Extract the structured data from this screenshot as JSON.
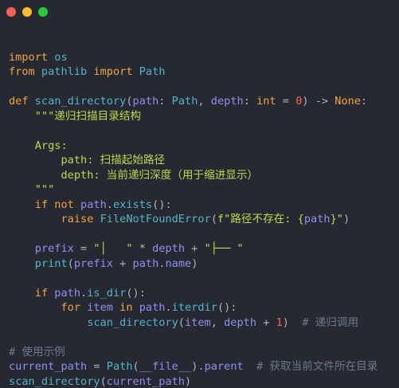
{
  "window": {
    "background": "#262932",
    "dots": [
      {
        "name": "close",
        "color": "#ff5f56"
      },
      {
        "name": "minimize",
        "color": "#ffbd2e"
      },
      {
        "name": "maximize",
        "color": "#27c93f"
      }
    ]
  },
  "palette": {
    "keyword": "#f0a53c",
    "func": "#52b4c9",
    "type": "#f0a53c",
    "plain": "#abb2bf",
    "variable": "#8f8ff0",
    "param": "#8f8ff0",
    "number": "#ff5f56",
    "string": "#bfd84a",
    "comment": "#6c7a8a"
  },
  "code": {
    "lines": [
      [],
      [
        {
          "t": "import",
          "c": "keyword"
        },
        {
          "t": " os",
          "c": "func"
        }
      ],
      [
        {
          "t": "from",
          "c": "keyword"
        },
        {
          "t": " pathlib ",
          "c": "func"
        },
        {
          "t": "import",
          "c": "keyword"
        },
        {
          "t": " Path",
          "c": "func"
        }
      ],
      [],
      [
        {
          "t": "def",
          "c": "keyword"
        },
        {
          "t": " scan_directory",
          "c": "func"
        },
        {
          "t": "(",
          "c": "plain"
        },
        {
          "t": "path",
          "c": "param"
        },
        {
          "t": ": ",
          "c": "plain"
        },
        {
          "t": "Path",
          "c": "func"
        },
        {
          "t": ", ",
          "c": "plain"
        },
        {
          "t": "depth",
          "c": "param"
        },
        {
          "t": ": ",
          "c": "plain"
        },
        {
          "t": "int",
          "c": "type"
        },
        {
          "t": " = ",
          "c": "plain"
        },
        {
          "t": "0",
          "c": "number"
        },
        {
          "t": ") -> ",
          "c": "plain"
        },
        {
          "t": "None",
          "c": "keyword"
        },
        {
          "t": ":",
          "c": "plain"
        }
      ],
      [
        {
          "t": "    \"\"\"递归扫描目录结构",
          "c": "string"
        }
      ],
      [],
      [
        {
          "t": "    Args:",
          "c": "string"
        }
      ],
      [
        {
          "t": "        path: 扫描起始路径",
          "c": "string"
        }
      ],
      [
        {
          "t": "        depth: 当前递归深度（用于缩进显示）",
          "c": "string"
        }
      ],
      [
        {
          "t": "    \"\"\"",
          "c": "string"
        }
      ],
      [
        {
          "t": "    ",
          "c": "plain"
        },
        {
          "t": "if not",
          "c": "keyword"
        },
        {
          "t": " path",
          "c": "variable"
        },
        {
          "t": ".",
          "c": "plain"
        },
        {
          "t": "exists",
          "c": "func"
        },
        {
          "t": "():",
          "c": "plain"
        }
      ],
      [
        {
          "t": "        ",
          "c": "plain"
        },
        {
          "t": "raise",
          "c": "keyword"
        },
        {
          "t": " FileNotFoundError",
          "c": "func"
        },
        {
          "t": "(",
          "c": "plain"
        },
        {
          "t": "f\"路径不存在: {",
          "c": "string"
        },
        {
          "t": "path",
          "c": "variable"
        },
        {
          "t": "}\"",
          "c": "string"
        },
        {
          "t": ")",
          "c": "plain"
        }
      ],
      [],
      [
        {
          "t": "    prefix",
          "c": "variable"
        },
        {
          "t": " = ",
          "c": "plain"
        },
        {
          "t": "\"│   \"",
          "c": "string"
        },
        {
          "t": " * ",
          "c": "plain"
        },
        {
          "t": "depth",
          "c": "variable"
        },
        {
          "t": " + ",
          "c": "plain"
        },
        {
          "t": "\"├── \"",
          "c": "string"
        }
      ],
      [
        {
          "t": "    ",
          "c": "plain"
        },
        {
          "t": "print",
          "c": "func"
        },
        {
          "t": "(",
          "c": "plain"
        },
        {
          "t": "prefix",
          "c": "variable"
        },
        {
          "t": " + ",
          "c": "plain"
        },
        {
          "t": "path",
          "c": "variable"
        },
        {
          "t": ".",
          "c": "plain"
        },
        {
          "t": "name",
          "c": "variable"
        },
        {
          "t": ")",
          "c": "plain"
        }
      ],
      [],
      [
        {
          "t": "    ",
          "c": "plain"
        },
        {
          "t": "if",
          "c": "keyword"
        },
        {
          "t": " path",
          "c": "variable"
        },
        {
          "t": ".",
          "c": "plain"
        },
        {
          "t": "is_dir",
          "c": "func"
        },
        {
          "t": "():",
          "c": "plain"
        }
      ],
      [
        {
          "t": "        ",
          "c": "plain"
        },
        {
          "t": "for",
          "c": "keyword"
        },
        {
          "t": " item ",
          "c": "variable"
        },
        {
          "t": "in",
          "c": "keyword"
        },
        {
          "t": " path",
          "c": "variable"
        },
        {
          "t": ".",
          "c": "plain"
        },
        {
          "t": "iterdir",
          "c": "func"
        },
        {
          "t": "():",
          "c": "plain"
        }
      ],
      [
        {
          "t": "            ",
          "c": "plain"
        },
        {
          "t": "scan_directory",
          "c": "func"
        },
        {
          "t": "(",
          "c": "plain"
        },
        {
          "t": "item",
          "c": "variable"
        },
        {
          "t": ", ",
          "c": "plain"
        },
        {
          "t": "depth",
          "c": "variable"
        },
        {
          "t": " + ",
          "c": "plain"
        },
        {
          "t": "1",
          "c": "number"
        },
        {
          "t": ")  ",
          "c": "plain"
        },
        {
          "t": "# 递归调用",
          "c": "comment"
        }
      ],
      [],
      [
        {
          "t": "# 使用示例",
          "c": "comment"
        }
      ],
      [
        {
          "t": "current_path",
          "c": "variable"
        },
        {
          "t": " = ",
          "c": "plain"
        },
        {
          "t": "Path",
          "c": "func"
        },
        {
          "t": "(",
          "c": "plain"
        },
        {
          "t": "__file__",
          "c": "variable"
        },
        {
          "t": ").",
          "c": "plain"
        },
        {
          "t": "parent",
          "c": "variable"
        },
        {
          "t": "  ",
          "c": "plain"
        },
        {
          "t": "# 获取当前文件所在目录",
          "c": "comment"
        }
      ],
      [
        {
          "t": "scan_directory",
          "c": "func"
        },
        {
          "t": "(",
          "c": "plain"
        },
        {
          "t": "current_path",
          "c": "variable"
        },
        {
          "t": ")",
          "c": "plain"
        }
      ]
    ]
  }
}
